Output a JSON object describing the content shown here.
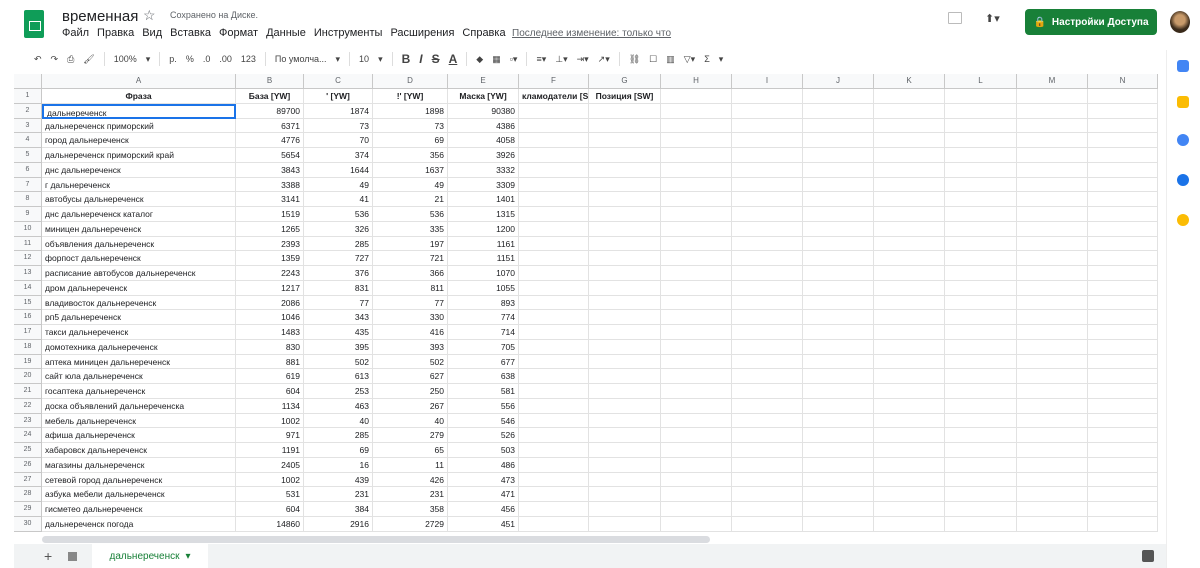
{
  "app": {
    "title": "временная",
    "saved_status": "Сохранено на Диске.",
    "last_edit": "Последнее изменение: только что",
    "share_label": "Настройки Доступа",
    "brand_color": "#188038"
  },
  "menu": [
    "Файл",
    "Правка",
    "Вид",
    "Вставка",
    "Формат",
    "Данные",
    "Инструменты",
    "Расширения",
    "Справка"
  ],
  "toolbar": {
    "zoom": "100%",
    "currency": "р.",
    "percent": "%",
    "dec_less": ".0",
    "dec_more": ".00",
    "format": "123",
    "font": "По умолча...",
    "font_size": "10",
    "bold": "B",
    "italic": "I",
    "strike": "S",
    "text_color": "A",
    "sum": "Σ"
  },
  "columns": [
    "A",
    "B",
    "C",
    "D",
    "E",
    "F",
    "G",
    "H",
    "I",
    "J",
    "K",
    "L",
    "M",
    "N"
  ],
  "headers": [
    "Фраза",
    "База [YW]",
    "' [YW]",
    "!' [YW]",
    "Маска [YW]",
    "кламодатели [S",
    "Позиция [SW]"
  ],
  "rows": [
    [
      "дальнереченск",
      "89700",
      "1874",
      "1898",
      "90380"
    ],
    [
      "дальнереченск приморский",
      "6371",
      "73",
      "73",
      "4386"
    ],
    [
      "город дальнереченск",
      "4776",
      "70",
      "69",
      "4058"
    ],
    [
      "дальнереченск приморский край",
      "5654",
      "374",
      "356",
      "3926"
    ],
    [
      "днс дальнереченск",
      "3843",
      "1644",
      "1637",
      "3332"
    ],
    [
      "г дальнереченск",
      "3388",
      "49",
      "49",
      "3309"
    ],
    [
      "автобусы дальнереченск",
      "3141",
      "41",
      "21",
      "1401"
    ],
    [
      "днс дальнереченск каталог",
      "1519",
      "536",
      "536",
      "1315"
    ],
    [
      "миницен дальнереченск",
      "1265",
      "326",
      "335",
      "1200"
    ],
    [
      "объявления дальнереченск",
      "2393",
      "285",
      "197",
      "1161"
    ],
    [
      "форпост дальнереченск",
      "1359",
      "727",
      "721",
      "1151"
    ],
    [
      "расписание автобусов дальнереченск",
      "2243",
      "376",
      "366",
      "1070"
    ],
    [
      "дром дальнереченск",
      "1217",
      "831",
      "811",
      "1055"
    ],
    [
      "владивосток дальнереченск",
      "2086",
      "77",
      "77",
      "893"
    ],
    [
      "рп5 дальнереченск",
      "1046",
      "343",
      "330",
      "774"
    ],
    [
      "такси дальнереченск",
      "1483",
      "435",
      "416",
      "714"
    ],
    [
      "домотехника дальнереченск",
      "830",
      "395",
      "393",
      "705"
    ],
    [
      "аптека миницен дальнереченск",
      "881",
      "502",
      "502",
      "677"
    ],
    [
      "сайт юла дальнереченск",
      "619",
      "613",
      "627",
      "638"
    ],
    [
      "госаптека дальнереченск",
      "604",
      "253",
      "250",
      "581"
    ],
    [
      "доска объявлений дальнереченска",
      "1134",
      "463",
      "267",
      "556"
    ],
    [
      "мебель дальнереченск",
      "1002",
      "40",
      "40",
      "546"
    ],
    [
      "афиша дальнереченск",
      "971",
      "285",
      "279",
      "526"
    ],
    [
      "хабаровск дальнереченск",
      "1191",
      "69",
      "65",
      "503"
    ],
    [
      "магазины дальнереченск",
      "2405",
      "16",
      "11",
      "486"
    ],
    [
      "сетевой город дальнереченск",
      "1002",
      "439",
      "426",
      "473"
    ],
    [
      "азбука мебели дальнереченск",
      "531",
      "231",
      "231",
      "471"
    ],
    [
      "гисметео дальнереченск",
      "604",
      "384",
      "358",
      "456"
    ],
    [
      "дальнереченск погода",
      "14860",
      "2916",
      "2729",
      "451"
    ]
  ],
  "sheet_tab": "дальнереченск",
  "icons": {
    "add_sheet": "+"
  }
}
